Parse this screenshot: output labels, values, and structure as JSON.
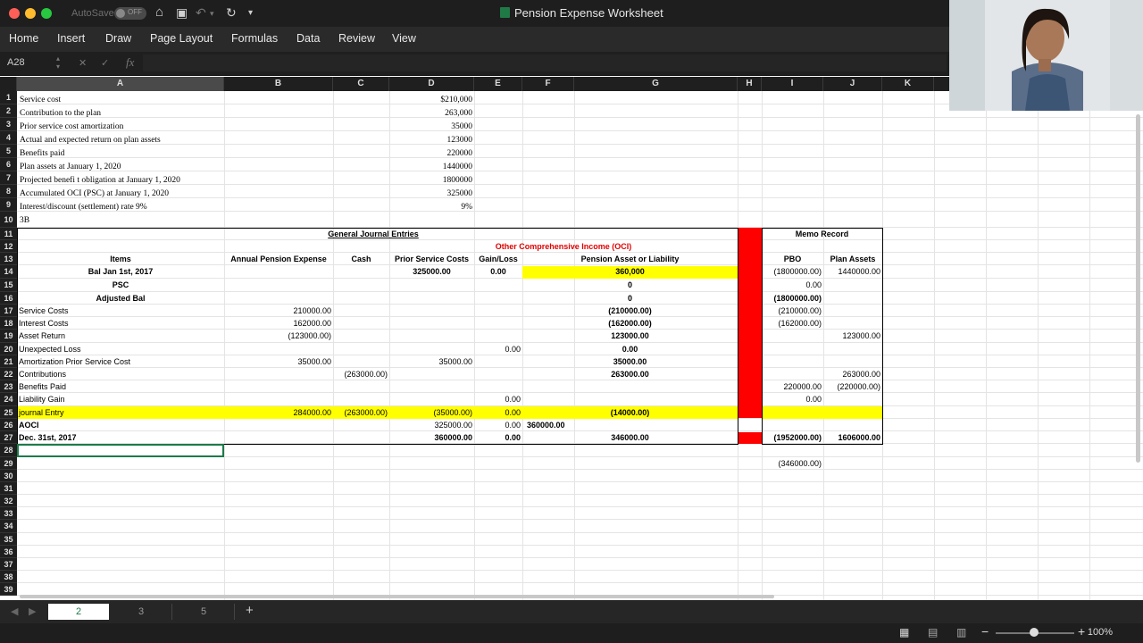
{
  "window": {
    "title": "Pension Expense Worksheet",
    "autosave_label": "AutoSave",
    "autosave_state": "OFF"
  },
  "ribbon": {
    "tabs": [
      "Home",
      "Insert",
      "Draw",
      "Page Layout",
      "Formulas",
      "Data",
      "Review",
      "View"
    ]
  },
  "formula_bar": {
    "name_box": "A28",
    "fx_label": "fx",
    "cancel_glyph": "✕",
    "confirm_glyph": "✓"
  },
  "columns": [
    "A",
    "B",
    "C",
    "D",
    "E",
    "F",
    "G",
    "H",
    "I",
    "J",
    "K"
  ],
  "rows": [
    "1",
    "2",
    "3",
    "4",
    "5",
    "6",
    "7",
    "8",
    "9",
    "10",
    "11",
    "12",
    "13",
    "14",
    "15",
    "16",
    "17",
    "18",
    "19",
    "20",
    "21",
    "22",
    "23",
    "24",
    "25",
    "26",
    "27",
    "28",
    "29",
    "30",
    "31",
    "32",
    "33",
    "34",
    "35",
    "36",
    "37",
    "38",
    "39"
  ],
  "sheet": {
    "given": {
      "labels": [
        "Service cost",
        "Contribution to the plan",
        "Prior service cost amortization",
        "Actual and expected return on plan assets",
        "Benefits paid",
        "Plan assets at January 1, 2020",
        "Projected benefi t obligation at January 1, 2020",
        "Accumulated OCI (PSC) at January 1, 2020",
        "Interest/discount (settlement) rate 9%",
        "3B"
      ],
      "values": [
        "$210,000",
        "263,000",
        "35000",
        "123000",
        "220000",
        "1440000",
        "1800000",
        "325000",
        "9%"
      ]
    },
    "headers": {
      "general_journal": "General Journal Entries",
      "memo_record": "Memo Record",
      "oci": "Other Comprehensive Income (OCI)",
      "items": "Items",
      "annual_pension_expense": "Annual Pension Expense",
      "cash": "Cash",
      "prior_service_costs": "Prior Service Costs",
      "gain_loss": "Gain/Loss",
      "pension_asset_liability": "Pension Asset or Liability",
      "pbo": "PBO",
      "plan_assets": "Plan Assets"
    },
    "r14": {
      "item": "Bal Jan 1st, 2017",
      "psc": "325000.00",
      "gl": "0.00",
      "pal": "360,000",
      "pbo": "(1800000.00)",
      "pa": "1440000.00"
    },
    "r15": {
      "item": "PSC",
      "pal": "0",
      "pbo": "0.00"
    },
    "r16": {
      "item": "Adjusted Bal",
      "pal": "0",
      "pbo": "(1800000.00)"
    },
    "r17": {
      "item": "Service Costs",
      "ape": "210000.00",
      "pal": "(210000.00)",
      "pbo": "(210000.00)"
    },
    "r18": {
      "item": "Interest Costs",
      "ape": "162000.00",
      "pal": "(162000.00)",
      "pbo": "(162000.00)"
    },
    "r19": {
      "item": "Asset Return",
      "ape": "(123000.00)",
      "pal": "123000.00",
      "pa": "123000.00"
    },
    "r20": {
      "item": "Unexpected Loss",
      "gl": "0.00",
      "pal": "0.00"
    },
    "r21": {
      "item": "Amortization Prior Service Cost",
      "ape": "35000.00",
      "psc": "35000.00",
      "pal": "35000.00"
    },
    "r22": {
      "item": "Contributions",
      "cash": "(263000.00)",
      "pal": "263000.00",
      "pa": "263000.00"
    },
    "r23": {
      "item": "Benefits Paid",
      "pbo": "220000.00",
      "pa": "(220000.00)"
    },
    "r24": {
      "item": "Liability Gain",
      "gl": "0.00",
      "pbo": "0.00"
    },
    "r25": {
      "item": "journal Entry",
      "ape": "284000.00",
      "cash": "(263000.00)",
      "psc": "(35000.00)",
      "gl": "0.00",
      "pal": "(14000.00)"
    },
    "r26": {
      "item": "AOCI",
      "psc": "325000.00",
      "gl": "0.00",
      "f": "360000.00"
    },
    "r27": {
      "item": "Dec. 31st, 2017",
      "psc": "360000.00",
      "gl": "0.00",
      "pal": "346000.00",
      "pbo": "(1952000.00)",
      "pa": "1606000.00"
    },
    "r29": {
      "pbo": "(346000.00)"
    }
  },
  "sheet_tabs": [
    "2",
    "3",
    "5"
  ],
  "add_sheet": "+",
  "zoom": "100%",
  "colors": {
    "excel_green": "#1d7a4a",
    "highlight_yellow": "#ffff00",
    "separator_red": "#ff0000",
    "oci_red": "#e00000"
  }
}
